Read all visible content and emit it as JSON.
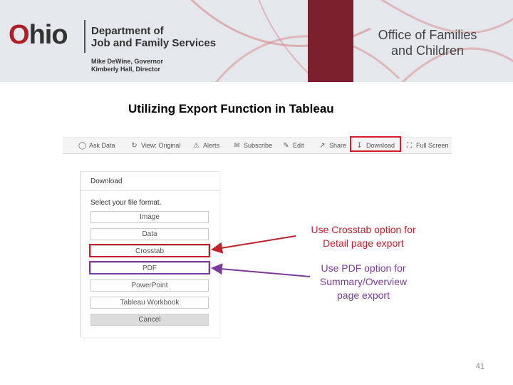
{
  "header": {
    "logo_text_o": "O",
    "logo_text_rest": "hio",
    "dept_line_1": "Department of",
    "dept_line_2": "Job and Family Services",
    "official_1": "Mike DeWine, Governor",
    "official_2": "Kimberly Hall, Director",
    "office_line_1": "Office of Families",
    "office_line_2": "and Children",
    "colors": {
      "maroon": "#7a1f2b",
      "ohio_red": "#b01f24",
      "banner_bg": "#e4e7ec"
    }
  },
  "slide": {
    "title": "Utilizing Export Function in Tableau",
    "page_number": "41"
  },
  "toolbar": {
    "items": [
      {
        "label": "Ask Data",
        "icon": "ask-data-icon"
      },
      {
        "label": "View: Original",
        "icon": "view-icon"
      },
      {
        "label": "Alerts",
        "icon": "alert-icon"
      },
      {
        "label": "Subscribe",
        "icon": "subscribe-icon"
      },
      {
        "label": "Edit",
        "icon": "pencil-icon"
      },
      {
        "label": "Share",
        "icon": "share-icon"
      },
      {
        "label": "Download",
        "icon": "download-icon"
      },
      {
        "label": "Full Screen",
        "icon": "fullscreen-icon"
      }
    ],
    "highlight_color": "#d21f2b"
  },
  "download_panel": {
    "title": "Download",
    "subtitle": "Select your file format.",
    "options": [
      "Image",
      "Data",
      "Crosstab",
      "PDF",
      "PowerPoint",
      "Tableau Workbook"
    ],
    "cancel_label": "Cancel"
  },
  "callouts": {
    "crosstab_text_1": "Use Crosstab option for",
    "crosstab_text_2": "Detail page export",
    "crosstab_color": "#c0202c",
    "pdf_text_1": "Use PDF option for",
    "pdf_text_2": "Summary/Overview",
    "pdf_text_3": "page export",
    "pdf_color": "#7b3b9c"
  }
}
